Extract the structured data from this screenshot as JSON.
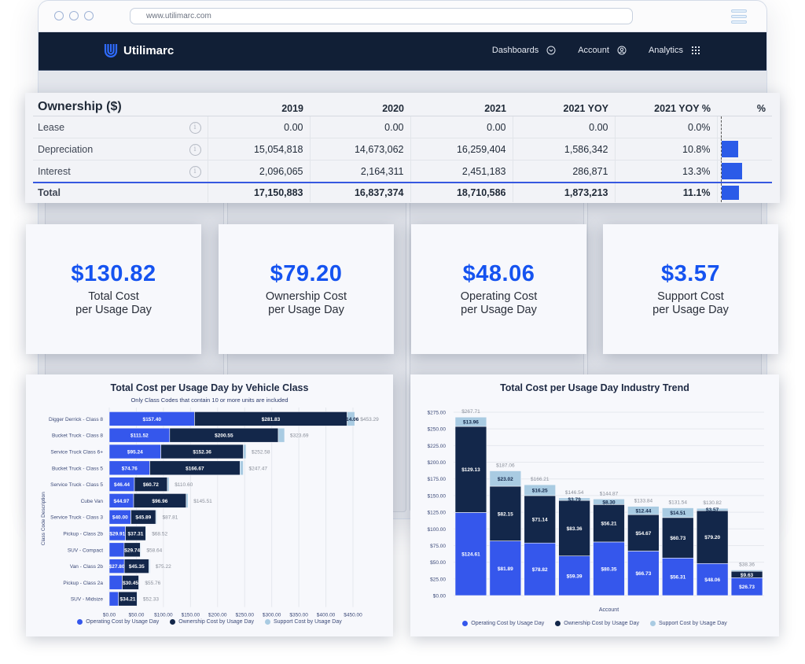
{
  "browser": {
    "url": "www.utilimarc.com"
  },
  "nav": {
    "brand": "Utilimarc",
    "items": [
      {
        "label": "Dashboards",
        "icon": "chevron-circle-down-icon"
      },
      {
        "label": "Account",
        "icon": "user-circle-icon"
      },
      {
        "label": "Analytics",
        "icon": "grid-dots-icon"
      }
    ]
  },
  "ownership_table": {
    "title": "Ownership ($)",
    "columns": [
      "2019",
      "2020",
      "2021",
      "2021 YOY",
      "2021 YOY %",
      "%"
    ],
    "rows": [
      {
        "label": "Lease",
        "values": [
          "0.00",
          "0.00",
          "0.00",
          "0.00",
          "0.0%"
        ],
        "pct": 0.0
      },
      {
        "label": "Depreciation",
        "values": [
          "15,054,818",
          "14,673,062",
          "16,259,404",
          "1,586,342",
          "10.8%"
        ],
        "pct": 10.8
      },
      {
        "label": "Interest",
        "values": [
          "2,096,065",
          "2,164,311",
          "2,451,183",
          "286,871",
          "13.3%"
        ],
        "pct": 13.3
      }
    ],
    "total": {
      "label": "Total",
      "values": [
        "17,150,883",
        "16,837,374",
        "18,710,586",
        "1,873,213",
        "11.1%"
      ],
      "pct": 11.1
    }
  },
  "kpis": [
    {
      "value": "$130.82",
      "line1": "Total Cost",
      "line2": "per Usage Day"
    },
    {
      "value": "$79.20",
      "line1": "Ownership Cost",
      "line2": "per Usage Day"
    },
    {
      "value": "$48.06",
      "line1": "Operating Cost",
      "line2": "per Usage Day"
    },
    {
      "value": "$3.57",
      "line1": "Support Cost",
      "line2": "per Usage Day"
    }
  ],
  "colors": {
    "operating": "#3557ec",
    "ownership": "#13274a",
    "support": "#a9cbe2",
    "accent": "#1553f0"
  },
  "chart_data": [
    {
      "type": "bar",
      "orientation": "horizontal",
      "stacked": true,
      "title": "Total Cost per Usage Day by Vehicle Class",
      "subtitle": "Only Class Codes that contain 10 or more units are included",
      "ylabel": "Class Code Description",
      "xlabel": "",
      "xlim": [
        0,
        450
      ],
      "xticks": [
        "$0.00",
        "$50.00",
        "$100.00",
        "$150.00",
        "$200.00",
        "$250.00",
        "$300.00",
        "$350.00",
        "$400.00",
        "$450.00"
      ],
      "grid": true,
      "legend_position": "bottom",
      "categories": [
        "Digger Derrick - Class 8",
        "Bucket Truck - Class 8",
        "Service Truck Class 6+",
        "Bucket Truck - Class 5",
        "Service Truck - Class 5",
        "Cube Van",
        "Service Truck - Class 3",
        "Pickup - Class 2b",
        "SUV - Compact",
        "Van - Class 2b",
        "Pickup - Class 2a",
        "SUV - Midsize"
      ],
      "series": [
        {
          "name": "Operating Cost by Usage Day",
          "values": [
            157.4,
            111.52,
            95.24,
            74.76,
            46.44,
            44.97,
            40.0,
            29.91,
            27.5,
            27.8,
            24.0,
            17.0
          ],
          "labels": [
            "$157.40",
            "$111.52",
            "$95.24",
            "$74.76",
            "$46.44",
            "$44.97",
            "$40.00",
            "$29.91",
            "",
            "$27.80",
            "",
            ""
          ]
        },
        {
          "name": "Ownership Cost by Usage Day",
          "values": [
            281.83,
            200.55,
            152.36,
            166.67,
            60.72,
            96.96,
            45.89,
            37.31,
            29.74,
            45.35,
            30.45,
            34.21
          ],
          "labels": [
            "$281.83",
            "$200.55",
            "$152.36",
            "$166.67",
            "$60.72",
            "$96.96",
            "$45.89",
            "$37.31",
            "$29.74",
            "$45.35",
            "$30.45",
            "$34.21"
          ]
        },
        {
          "name": "Support Cost by Usage Day",
          "values": [
            14.06,
            11.62,
            4.98,
            6.04,
            3.44,
            3.58,
            1.92,
            1.3,
            1.4,
            2.07,
            1.31,
            1.12
          ],
          "labels": [
            "$14.06",
            "",
            "",
            "",
            "",
            "",
            "",
            "",
            "",
            "",
            "",
            ""
          ]
        }
      ],
      "totals": [
        "$453.29",
        "$323.69",
        "$252.58",
        "$247.47",
        "$110.60",
        "$145.51",
        "$87.81",
        "$68.52",
        "$58.64",
        "$75.22",
        "$55.76",
        "$52.33"
      ]
    },
    {
      "type": "bar",
      "orientation": "vertical",
      "stacked": true,
      "title": "Total Cost per Usage Day Industry Trend",
      "xlabel": "Account",
      "ylabel": "",
      "ylim": [
        0,
        275
      ],
      "yticks": [
        "$0.00",
        "$25.00",
        "$50.00",
        "$75.00",
        "$100.00",
        "$125.00",
        "$150.00",
        "$175.00",
        "$200.00",
        "$225.00",
        "$250.00",
        "$275.00"
      ],
      "grid": true,
      "legend_position": "bottom",
      "categories": [
        "",
        "",
        "",
        "",
        "",
        "",
        "",
        "",
        ""
      ],
      "series": [
        {
          "name": "Operating Cost by Usage Day",
          "values": [
            124.61,
            81.89,
            78.82,
            59.39,
            80.35,
            66.73,
            56.31,
            48.06,
            26.73
          ],
          "labels": [
            "$124.61",
            "$81.89",
            "$78.82",
            "$59.39",
            "$80.35",
            "$66.73",
            "$56.31",
            "$48.06",
            "$26.73"
          ]
        },
        {
          "name": "Ownership Cost by Usage Day",
          "values": [
            129.13,
            82.15,
            71.14,
            83.36,
            56.21,
            54.67,
            60.73,
            79.2,
            9.63
          ],
          "labels": [
            "$129.13",
            "$82.15",
            "$71.14",
            "$83.36",
            "$56.21",
            "$54.67",
            "$60.73",
            "$79.20",
            "$9.63"
          ]
        },
        {
          "name": "Support Cost by Usage Day",
          "values": [
            13.96,
            23.02,
            16.25,
            3.79,
            8.3,
            12.44,
            14.51,
            3.57,
            2.0
          ],
          "labels": [
            "$13.96",
            "$23.02",
            "$16.25",
            "$3.79",
            "$8.30",
            "$12.44",
            "$14.51",
            "$3.57",
            ""
          ]
        }
      ],
      "totals": [
        "$267.71",
        "$187.06",
        "$166.21",
        "$146.54",
        "$144.87",
        "$133.84",
        "$131.54",
        "$130.82",
        "$38.36"
      ]
    }
  ]
}
